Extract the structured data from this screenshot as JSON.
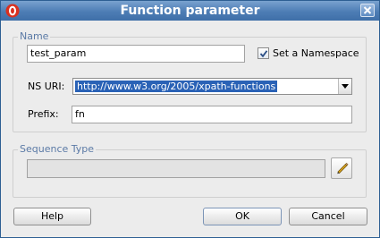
{
  "window": {
    "title": "Function parameter"
  },
  "name_group": {
    "legend": "Name",
    "name_value": "test_param",
    "set_namespace_label": "Set a Namespace",
    "set_namespace_checked": true,
    "ns_uri_label": "NS URI:",
    "ns_uri_value": "http://www.w3.org/2005/xpath-functions",
    "prefix_label": "Prefix:",
    "prefix_value": "fn"
  },
  "sequence_group": {
    "legend": "Sequence Type",
    "value": ""
  },
  "buttons": {
    "help": "Help",
    "ok": "OK",
    "cancel": "Cancel"
  },
  "icons": {
    "app": "oracle-app-icon",
    "close": "close-icon",
    "check": "checkmark-icon",
    "dropdown": "chevron-down-icon",
    "edit": "pencil-icon"
  },
  "colors": {
    "titlebar": "#4d7db5",
    "selection": "#2a62b6",
    "legend": "#5b7aa6"
  }
}
